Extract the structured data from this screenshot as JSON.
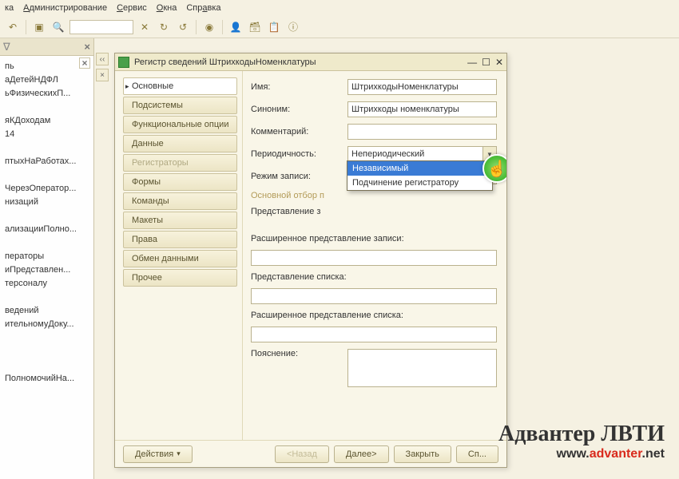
{
  "menubar": [
    "ка",
    "Администрирование",
    "Сервис",
    "Окна",
    "Справка"
  ],
  "toolbar_icons": [
    "undo-icon",
    "search-panel-icon",
    "search-icon",
    "clear-icon",
    "refresh-icon",
    "nav-icon",
    "stop-icon",
    "record-icon",
    "user-icon",
    "db-icon",
    "docs-icon",
    "info-icon"
  ],
  "left_panel": {
    "tree": [
      "пь",
      "аДетейНДФЛ",
      "ьФизическихП...",
      "",
      "яКДоходам",
      "14",
      "",
      "птыхНаРаботах...",
      "",
      "ЧерезОператор...",
      "низаций",
      "",
      "ализацииПолно...",
      "",
      "ператоры",
      "иПредставлен...",
      "терсоналу",
      "",
      "ведений",
      "ительномуДоку...",
      "",
      "",
      "",
      "ПолномочийНа..."
    ]
  },
  "window": {
    "title": "Регистр сведений ШтрихкодыНоменклатуры",
    "tabs": [
      {
        "label": "Основные",
        "state": "active"
      },
      {
        "label": "Подсистемы",
        "state": "normal"
      },
      {
        "label": "Функциональные опции",
        "state": "normal"
      },
      {
        "label": "Данные",
        "state": "normal"
      },
      {
        "label": "Регистраторы",
        "state": "disabled"
      },
      {
        "label": "Формы",
        "state": "normal"
      },
      {
        "label": "Команды",
        "state": "normal"
      },
      {
        "label": "Макеты",
        "state": "normal"
      },
      {
        "label": "Права",
        "state": "normal"
      },
      {
        "label": "Обмен данными",
        "state": "normal"
      },
      {
        "label": "Прочее",
        "state": "normal"
      }
    ],
    "fields": {
      "name_label": "Имя:",
      "name_value": "ШтрихкодыНоменклатуры",
      "synonym_label": "Синоним:",
      "synonym_value": "Штрихкоды номенклатуры",
      "comment_label": "Комментарий:",
      "comment_value": "",
      "periodicity_label": "Периодичность:",
      "periodicity_value": "Непериодический",
      "writemode_label": "Режим записи:",
      "writemode_value": "Независимый",
      "writemode_options": [
        "Независимый",
        "Подчинение регистратору"
      ],
      "filter_label": "Основной отбор п",
      "record_repr_label": "Представление з",
      "ext_record_repr_label": "Расширенное представление записи:",
      "list_repr_label": "Представление списка:",
      "ext_list_repr_label": "Расширенное представление списка:",
      "explanation_label": "Пояснение:"
    },
    "footer": {
      "actions": "Действия",
      "back": "<Назад",
      "next": "Далее>",
      "close": "Закрыть",
      "help": "Сп..."
    }
  },
  "watermark": {
    "title": "Адвантер ЛВТИ",
    "url_pre": "www.",
    "url_mid": "advanter",
    "url_post": ".net"
  }
}
